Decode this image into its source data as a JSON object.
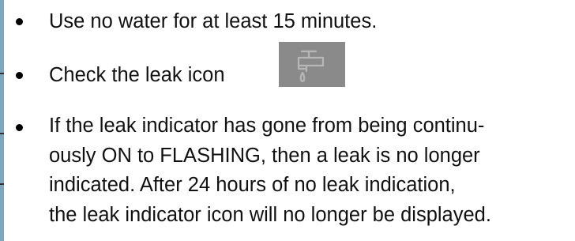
{
  "items": [
    {
      "text": "Use no water for at least 15 minutes."
    },
    {
      "text": "Check the  leak icon"
    },
    {
      "lines": [
        " If the leak indicator has gone from being continu-",
        "ously ON to FLASHING, then a leak is no longer",
        "indicated. After 24 hours of no leak indication,",
        "the leak indicator icon will no longer be displayed."
      ]
    }
  ],
  "icons": {
    "leak_icon": "faucet-drip-icon"
  },
  "colors": {
    "text": "#111111",
    "icon_background": "#8a8a8a",
    "left_border": "#7ea6bc"
  }
}
